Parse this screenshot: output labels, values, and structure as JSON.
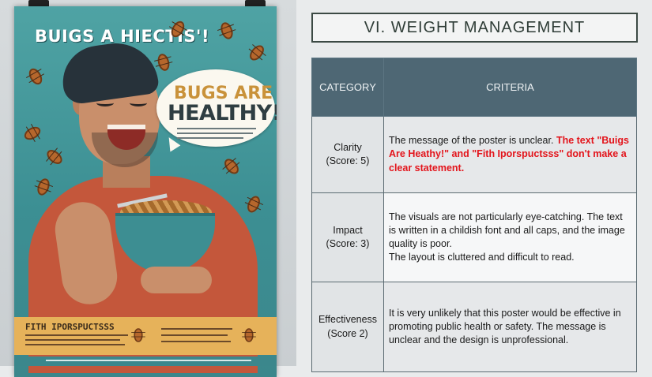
{
  "poster": {
    "headline": "BUIGS A HIECTIS'!",
    "bubble_line1": "BUGS ARE",
    "bubble_line2": "HEALTHY!",
    "bottom_title": "FITH   IPORSPUCTSSS"
  },
  "slide": {
    "title": "VI. WEIGHT MANAGEMENT",
    "table": {
      "headers": [
        "CATEGORY",
        "CRITERIA"
      ],
      "rows": [
        {
          "category": "Clarity",
          "score": "(Score: 5)",
          "criteria": "The message of the poster is unclear.",
          "criteria_highlight": "The text \"Buigs Are Heathy!\" and \"Fith Iporspuctsss\" don't make a clear statement."
        },
        {
          "category": "Impact",
          "score": "(Score: 3)",
          "criteria": "The visuals are not particularly eye-catching. The text is written in a childish font and all caps, and the image quality is poor.",
          "criteria_extra": "The layout is cluttered and difficult to read."
        },
        {
          "category": "Effectiveness",
          "score": "(Score 2)",
          "criteria": "It is very unlikely that this poster would be effective in promoting public health or safety. The message is unclear and the design is unprofessional."
        }
      ]
    }
  },
  "colors": {
    "header_bg": "#4e6774",
    "highlight_red": "#e3141b",
    "poster_teal": "#4fa3a4",
    "shirt": "#c4573b"
  },
  "icons": [
    "binder-clip-icon",
    "bug-icon"
  ]
}
